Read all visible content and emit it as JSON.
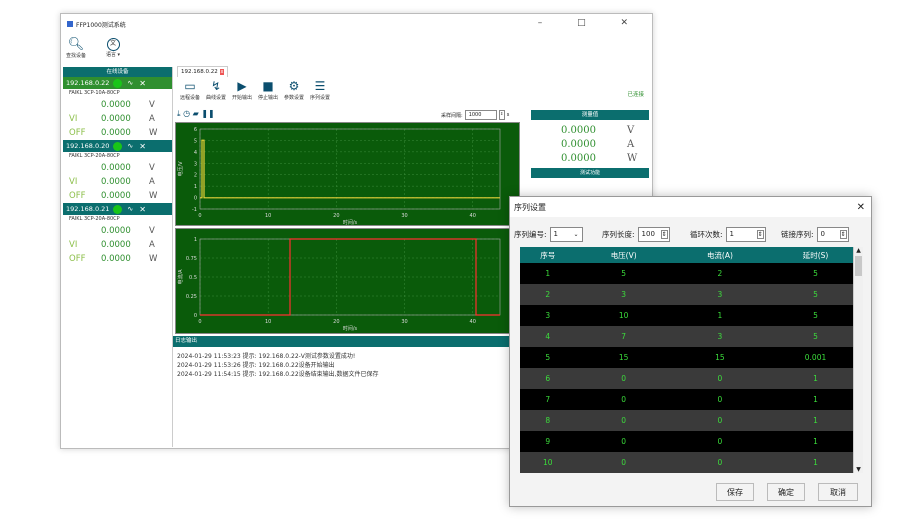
{
  "window": {
    "title": "FFP1000测试系统",
    "controls": "–  □  ✕"
  },
  "toolbar_left": {
    "search_label": "查找设备",
    "lang_label": "语言 ▾"
  },
  "device_panel": {
    "header": "在线设备",
    "devices": [
      {
        "ip": "192.168.0.22",
        "model": "FAIKL   3CP-10A-80CP",
        "rows": [
          {
            "l": "",
            "v": "0.0000",
            "u": "V"
          },
          {
            "l": "VI",
            "v": "0.0000",
            "u": "A"
          },
          {
            "l": "OFF",
            "v": "0.0000",
            "u": "W"
          }
        ]
      },
      {
        "ip": "192.168.0.20",
        "model": "FAIKL   3CP-20A-80CP",
        "rows": [
          {
            "l": "",
            "v": "0.0000",
            "u": "V"
          },
          {
            "l": "VI",
            "v": "0.0000",
            "u": "A"
          },
          {
            "l": "OFF",
            "v": "0.0000",
            "u": "W"
          }
        ]
      },
      {
        "ip": "192.168.0.21",
        "model": "FAIKL   3CP-20A-80CP",
        "rows": [
          {
            "l": "",
            "v": "0.0000",
            "u": "V"
          },
          {
            "l": "VI",
            "v": "0.0000",
            "u": "A"
          },
          {
            "l": "OFF",
            "v": "0.0000",
            "u": "W"
          }
        ]
      }
    ]
  },
  "tab": {
    "label": "192.168.0.22"
  },
  "tools": [
    "远程设备",
    "曲线设置",
    "开始输出",
    "停止输出",
    "参数设置",
    "序列设置"
  ],
  "status_right": "已连接",
  "sample": {
    "label": "采样间隔:",
    "value": "1000",
    "unit": "s"
  },
  "readout": {
    "header": "测量值",
    "values": [
      {
        "v": "0.0000",
        "u": "V"
      },
      {
        "v": "0.0000",
        "u": "A"
      },
      {
        "v": "0.0000",
        "u": "W"
      }
    ],
    "sub_header": "测试功能"
  },
  "chart1": {
    "ylabel": "电压/V",
    "xlabel": "时间/s",
    "xticks": [
      "0",
      "10",
      "20",
      "30",
      "40"
    ],
    "yticks": [
      "6",
      "5",
      "4",
      "3",
      "2",
      "1",
      "0",
      "-1"
    ]
  },
  "chart2": {
    "ylabel": "电流/A",
    "xlabel": "时间/s",
    "xticks": [
      "0",
      "10",
      "20",
      "30",
      "40"
    ],
    "yticks": [
      "1",
      "0.75",
      "0.5",
      "0.25",
      "0"
    ]
  },
  "log": {
    "header": "日志输出",
    "lines": [
      "2024-01-29 11:53:23  提示: 192.168.0.22-V测试参数设置成功!",
      "2024-01-29 11:53:26  提示: 192.168.0.22设备开始输出",
      "2024-01-29 11:54:15  提示: 192.168.0.22设备结束输出,数据文件已保存"
    ]
  },
  "dialog": {
    "title": "序列设置",
    "close": "✕",
    "seq_no_label": "序列编号:",
    "seq_no_value": "1",
    "seq_len_label": "序列长度:",
    "seq_len_value": "100",
    "loops_label": "循环次数:",
    "loops_value": "1",
    "link_label": "链接序列:",
    "link_value": "0",
    "columns": [
      "序号",
      "电压(V)",
      "电流(A)",
      "延时(S)"
    ],
    "rows": [
      [
        "1",
        "5",
        "2",
        "5"
      ],
      [
        "2",
        "3",
        "3",
        "5"
      ],
      [
        "3",
        "10",
        "1",
        "5"
      ],
      [
        "4",
        "7",
        "3",
        "5"
      ],
      [
        "5",
        "15",
        "15",
        "0.001"
      ],
      [
        "6",
        "0",
        "0",
        "1"
      ],
      [
        "7",
        "0",
        "0",
        "1"
      ],
      [
        "8",
        "0",
        "0",
        "1"
      ],
      [
        "9",
        "0",
        "0",
        "1"
      ],
      [
        "10",
        "0",
        "0",
        "1"
      ]
    ],
    "save": "保存",
    "ok": "确定",
    "cancel": "取消"
  }
}
